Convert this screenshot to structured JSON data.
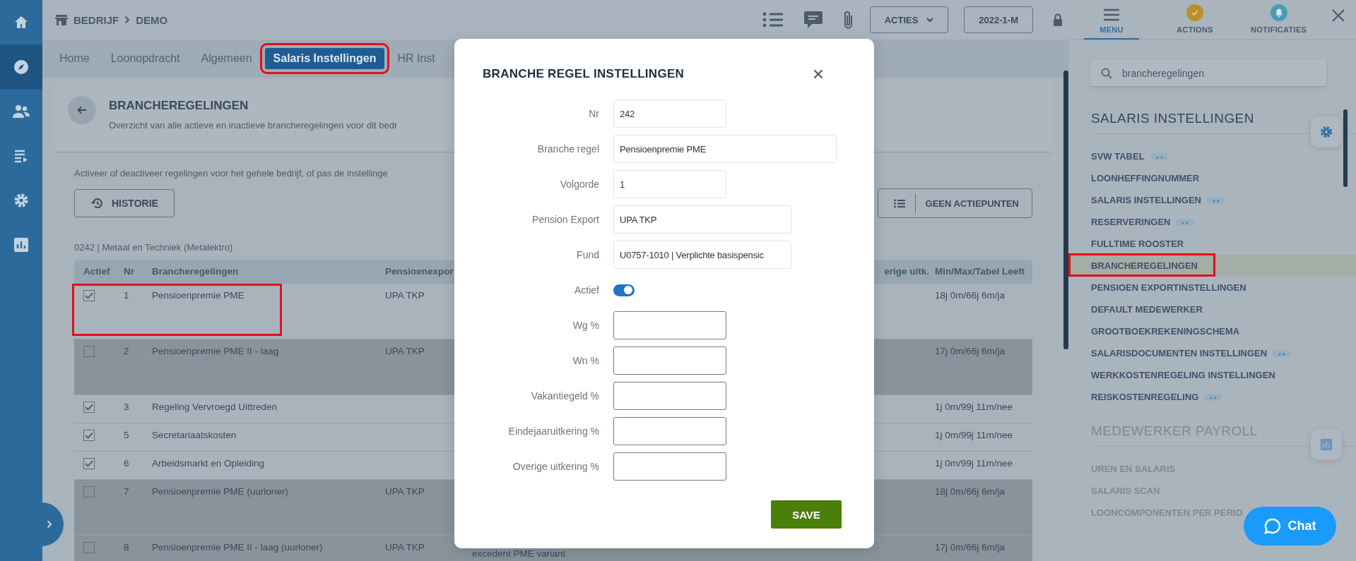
{
  "nav": {
    "items": [
      {
        "kind": "home",
        "selected": false
      },
      {
        "kind": "compass",
        "selected": true
      },
      {
        "kind": "people",
        "selected": false
      },
      {
        "kind": "list",
        "selected": false
      },
      {
        "kind": "gear",
        "selected": false
      },
      {
        "kind": "chart",
        "selected": false
      }
    ]
  },
  "topbar": {
    "breadcrumb": [
      "BEDRIJF",
      "DEMO"
    ],
    "actions_button": "ACTIES",
    "period_button": "2022-1-M"
  },
  "tabs": [
    {
      "label": "Home",
      "selected": false,
      "annotated": false
    },
    {
      "label": "Loonopdracht",
      "selected": false,
      "annotated": false
    },
    {
      "label": "Algemeen",
      "selected": false,
      "annotated": false
    },
    {
      "label": "Salaris Instellingen",
      "selected": true,
      "annotated": true
    },
    {
      "label": "HR Inst",
      "selected": false,
      "annotated": false
    }
  ],
  "page": {
    "title": "BRANCHEREGELINGEN",
    "description": "Overzicht van alle actieve en inactieve brancheregelingen voor dit bedr",
    "intro": "Activeer of deactiveer regelingen voor het gehele bedrijf, of pas de instellinge",
    "history_button": "HISTORIE",
    "actions_button": "GEEN ACTIEPUNTEN",
    "group_label": "0242 | Metaal en Techniek (Metalektro)"
  },
  "table": {
    "columns": {
      "actief": "Actief",
      "nr": "Nr",
      "name": "Brancheregelingen",
      "export": "Pensioenexpor",
      "other": "erige uitk.",
      "age": "Min/Max/Tabel Leeft"
    },
    "rows": [
      {
        "checked": true,
        "annotated": true,
        "nr": "1",
        "name": "Pensioenpremie PME",
        "export": "UPA TKP",
        "age": "18j 0m/66j 6m/ja"
      },
      {
        "checked": false,
        "annotated": false,
        "nr": "2",
        "name": "Pensioenpremie PME II - laag",
        "export": "UPA TKP",
        "age": "17j 0m/66j 6m/ja"
      },
      {
        "checked": true,
        "annotated": false,
        "nr": "3",
        "name": "Regeling Vervroegd Uittreden",
        "age": "1j 0m/99j 11m/nee"
      },
      {
        "checked": true,
        "annotated": false,
        "nr": "5",
        "name": "Secretariaatskosten",
        "age": "1j 0m/99j 11m/nee"
      },
      {
        "checked": true,
        "annotated": false,
        "nr": "6",
        "name": "Arbeidsmarkt en Opleiding",
        "age": "1j 0m/99j 11m/nee"
      },
      {
        "checked": false,
        "annotated": false,
        "nr": "7",
        "name": "Pensioenpremie PME (uurloner)",
        "export": "UPA TKP",
        "age": "18j 0m/66j 6m/ja"
      },
      {
        "checked": false,
        "annotated": false,
        "nr": "8",
        "name": "Pensioenpremie PME II - laag (uurloner)",
        "export": "UPA TKP",
        "note": "excedent PME variant",
        "age": "17j 0m/66j 6m/ja"
      }
    ]
  },
  "modal": {
    "title": "BRANCHE REGEL INSTELLINGEN",
    "fields": [
      {
        "label": "Nr",
        "kind": "number",
        "value": "242",
        "readonly": true
      },
      {
        "label": "Branche regel",
        "kind": "text",
        "value": "Pensioenpremie PME",
        "readonly": true
      },
      {
        "label": "Volgorde",
        "kind": "number",
        "value": "1",
        "readonly": true
      },
      {
        "label": "Pension Export",
        "kind": "select",
        "value": "UPA TKP",
        "readonly": true
      },
      {
        "label": "Fund",
        "kind": "select",
        "value": "U0757-1010 | Verplichte basispensic",
        "readonly": true
      },
      {
        "label": "Actief",
        "kind": "toggle",
        "on": true
      },
      {
        "label": "Wg %",
        "kind": "number",
        "readonly": false
      },
      {
        "label": "Wn %",
        "kind": "number",
        "readonly": false
      },
      {
        "label": "Vakantiegeld %",
        "kind": "number",
        "readonly": false
      },
      {
        "label": "Eindejaaruitkering %",
        "kind": "number",
        "readonly": false
      },
      {
        "label": "Overige uitkering %",
        "kind": "number",
        "readonly": false
      }
    ],
    "save_button": "SAVE"
  },
  "sidebar": {
    "tabs": [
      {
        "label": "MENU",
        "kind": "menu",
        "selected": true
      },
      {
        "label": "ACTIONS",
        "kind": "actions",
        "selected": false
      },
      {
        "label": "NOTIFICATIES",
        "kind": "bell",
        "selected": false
      }
    ],
    "search": {
      "value": "brancheregelingen"
    },
    "sections": [
      {
        "title": "SALARIS INSTELLINGEN",
        "kind": "settings",
        "faded": false,
        "items": [
          {
            "label": "SVW TABEL",
            "badge": true,
            "selected": false,
            "annotated": false
          },
          {
            "label": "LOONHEFFINGNUMMER",
            "badge": false,
            "selected": false,
            "annotated": false
          },
          {
            "label": "SALARIS INSTELLINGEN",
            "badge": true,
            "selected": false,
            "annotated": false
          },
          {
            "label": "RESERVERINGEN",
            "badge": true,
            "selected": false,
            "annotated": false
          },
          {
            "label": "FULLTIME ROOSTER",
            "badge": false,
            "selected": false,
            "annotated": false
          },
          {
            "label": "BRANCHEREGELINGEN",
            "badge": false,
            "selected": true,
            "annotated": true
          },
          {
            "label": "PENSIOEN EXPORTINSTELLINGEN",
            "badge": false,
            "selected": false,
            "annotated": false
          },
          {
            "label": "DEFAULT MEDEWERKER",
            "badge": false,
            "selected": false,
            "annotated": false
          },
          {
            "label": "GROOTBOEKREKENINGSCHEMA",
            "badge": false,
            "selected": false,
            "annotated": false
          },
          {
            "label": "SALARISDOCUMENTEN INSTELLINGEN",
            "badge": true,
            "selected": false,
            "annotated": false
          },
          {
            "label": "WERKKOSTENREGELING INSTELLINGEN",
            "badge": false,
            "selected": false,
            "annotated": false
          },
          {
            "label": "REISKOSTENREGELING",
            "badge": true,
            "selected": false,
            "annotated": false
          }
        ]
      },
      {
        "title": "MEDEWERKER PAYROLL",
        "kind": "chart",
        "faded": true,
        "items": [
          {
            "label": "UREN EN SALARIS",
            "badge": false,
            "selected": false,
            "annotated": false
          },
          {
            "label": "SALARIS SCAN",
            "badge": false,
            "selected": false,
            "annotated": false
          },
          {
            "label": "LOONCOMPONENTEN PER PERIO",
            "badge": false,
            "selected": false,
            "annotated": false
          }
        ]
      }
    ],
    "chat_button": "Chat"
  }
}
